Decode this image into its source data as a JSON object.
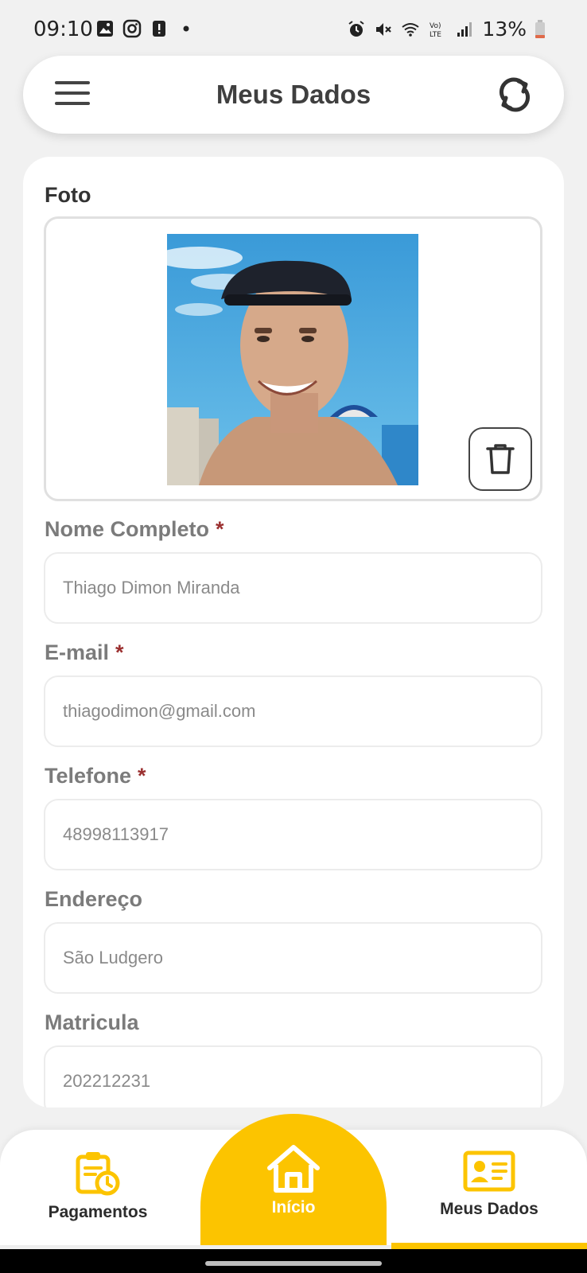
{
  "status": {
    "time": "09:10",
    "battery": "13%",
    "left_icons": [
      "gallery-icon",
      "instagram-icon",
      "alert-icon",
      "dot-icon"
    ],
    "right_icons": [
      "alarm-icon",
      "mute-icon",
      "wifi-icon",
      "volte-icon",
      "signal-icon",
      "battery-icon"
    ]
  },
  "header": {
    "title": "Meus Dados",
    "menu_icon": "hamburger-menu-icon",
    "sync_icon": "sync-icon"
  },
  "form": {
    "photo_label": "Foto",
    "required_mark": "*",
    "fields": [
      {
        "label": "Nome Completo",
        "required": true,
        "value": "Thiago Dimon Miranda"
      },
      {
        "label": "E-mail",
        "required": true,
        "value": "thiagodimon@gmail.com"
      },
      {
        "label": "Telefone",
        "required": true,
        "value": "48998113917"
      },
      {
        "label": "Endereço",
        "required": false,
        "value": "São Ludgero"
      },
      {
        "label": "Matricula",
        "required": false,
        "value": "202212231"
      }
    ]
  },
  "nav": {
    "items": [
      {
        "label": "Pagamentos",
        "icon": "payments-calendar-icon"
      },
      {
        "label": "Início",
        "icon": "home-icon"
      },
      {
        "label": "Meus Dados",
        "icon": "id-card-icon"
      }
    ],
    "accent_color": "#fcc400",
    "active_item": "Meus Dados"
  }
}
